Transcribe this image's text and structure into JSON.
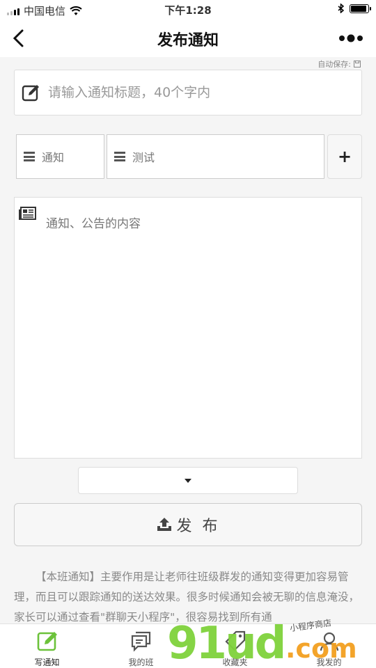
{
  "status_bar": {
    "carrier": "中国电信",
    "time": "下午1:28",
    "battery_level": 0.9
  },
  "nav": {
    "title": "发布通知"
  },
  "autosave": {
    "label": "自动保存:"
  },
  "form": {
    "title_placeholder": "请输入通知标题，40个字内",
    "tags": [
      {
        "label": "通知"
      },
      {
        "label": "测试"
      }
    ],
    "add_label": "+",
    "content_placeholder": "通知、公告的内容",
    "publish_label": "发 布"
  },
  "description": "【本班通知】主要作用是让老师往班级群发的通知变得更加容易管理，而且可以跟踪通知的送达效果。很多时候通知会被无聊的信息淹没，家长可以通过查看\"群聊天小程序\"，很容易找到所有通",
  "tabs": [
    {
      "label": "写通知",
      "icon": "write-icon",
      "active": true
    },
    {
      "label": "我的班",
      "icon": "chat-icon",
      "active": false
    },
    {
      "label": "收藏夹",
      "icon": "tag-icon",
      "active": false
    },
    {
      "label": "我发的",
      "icon": "user-icon",
      "active": false
    }
  ],
  "watermark": {
    "main": "91ud",
    "suffix": ".com",
    "small": "小程序商店"
  },
  "colors": {
    "accent_green": "#6cc23a",
    "watermark_green": "#7fd23c",
    "watermark_orange": "#f3a020"
  }
}
